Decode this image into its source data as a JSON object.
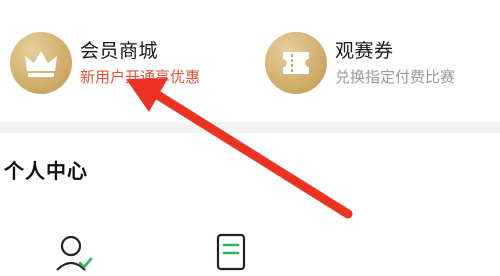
{
  "member_card": {
    "title": "会员商城",
    "subtitle": "新用户开通享优惠",
    "icon": "crown-icon",
    "subtitle_color": "#e0533e"
  },
  "ticket_card": {
    "title": "观赛券",
    "subtitle": "兑换指定付费比赛",
    "icon": "ticket-icon"
  },
  "personal_center": {
    "title": "个人中心",
    "items": [
      {
        "icon": "profile-check-icon"
      },
      {
        "icon": "document-icon"
      }
    ]
  },
  "accent_gold": "#cda862",
  "annotation_arrow_color": "#ea3323"
}
